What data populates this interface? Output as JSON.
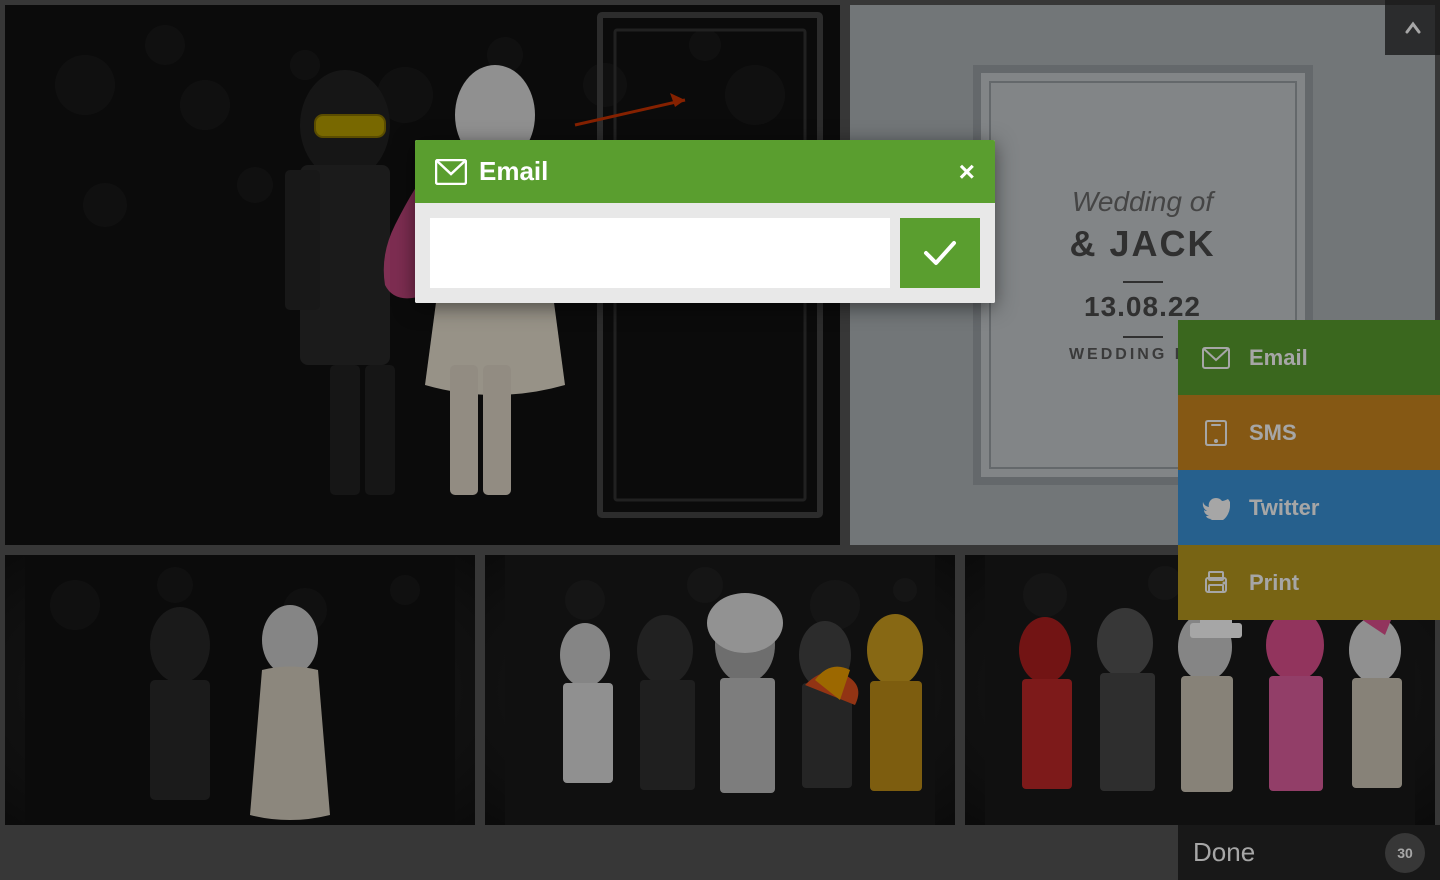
{
  "background": {
    "mainPhotoAlt": "Couple at wedding photo booth",
    "photo1Alt": "Two people posing",
    "photo2Alt": "Group photo at party",
    "photo3Alt": "Group photo with props"
  },
  "weddingCard": {
    "weddingOf": "Wedding of",
    "names": "& JACK",
    "date": "13.08.22",
    "weddingDay": "WEDDING DAY"
  },
  "actionButtons": {
    "email": "Email",
    "sms": "SMS",
    "twitter": "Twitter",
    "print": "Print"
  },
  "navigation": {
    "doneLabel": "Done",
    "timerValue": "30"
  },
  "emailModal": {
    "title": "Email",
    "closeBtnLabel": "×",
    "inputPlaceholder": "",
    "submitLabel": "✓"
  }
}
